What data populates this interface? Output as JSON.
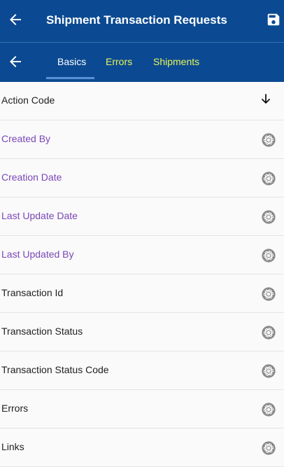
{
  "header": {
    "title": "Shipment Transaction Requests",
    "back_icon": "arrow-left-icon",
    "save_icon": "save-icon",
    "background": "#0b4a92"
  },
  "tabs": {
    "back_icon": "arrow-left-icon",
    "items": [
      {
        "label": "Basics",
        "active": true
      },
      {
        "label": "Errors",
        "active": false
      },
      {
        "label": "Shipments",
        "active": false
      }
    ],
    "active_color": "#ffffff",
    "inactive_color": "#e8f55a"
  },
  "fields": [
    {
      "label": "Action Code",
      "color": "dark",
      "icon": "sort-down-arrow-icon"
    },
    {
      "label": "Created By",
      "color": "purple",
      "icon": "aperture-icon"
    },
    {
      "label": "Creation Date",
      "color": "purple",
      "icon": "aperture-icon"
    },
    {
      "label": "Last Update Date",
      "color": "purple",
      "icon": "aperture-icon"
    },
    {
      "label": "Last Updated By",
      "color": "purple",
      "icon": "aperture-icon"
    },
    {
      "label": "Transaction Id",
      "color": "dark",
      "icon": "aperture-icon"
    },
    {
      "label": "Transaction Status",
      "color": "dark",
      "icon": "aperture-icon"
    },
    {
      "label": "Transaction Status Code",
      "color": "dark",
      "icon": "aperture-icon"
    },
    {
      "label": "Errors",
      "color": "dark",
      "icon": "aperture-icon"
    },
    {
      "label": "Links",
      "color": "dark",
      "icon": "aperture-icon"
    }
  ]
}
